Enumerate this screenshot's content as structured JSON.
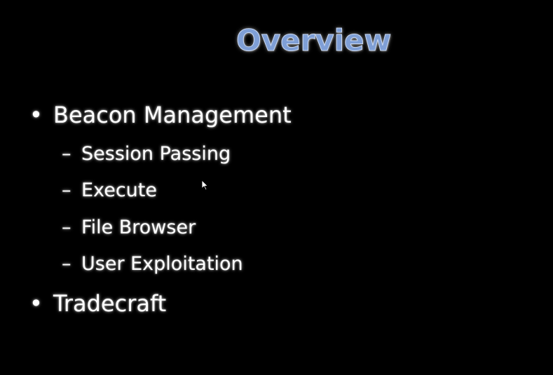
{
  "slide": {
    "title": "Overview",
    "title_color": "#7f9fd6",
    "background_color": "#000000",
    "text_color": "#ffffff",
    "bullet_marker": "•",
    "sub_marker": "–",
    "items": [
      {
        "label": "Beacon Management",
        "children": [
          {
            "label": "Session Passing"
          },
          {
            "label": "Execute"
          },
          {
            "label": "File Browser"
          },
          {
            "label": "User Exploitation"
          }
        ]
      },
      {
        "label": "Tradecraft",
        "children": []
      }
    ]
  },
  "cursor": {
    "icon": "arrow-cursor-icon"
  }
}
